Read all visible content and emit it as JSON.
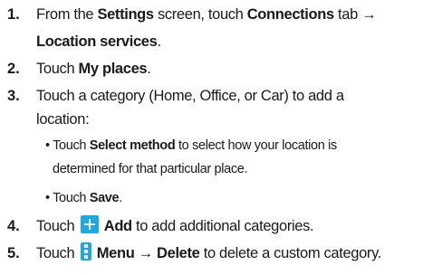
{
  "steps": [
    {
      "number": "1.",
      "line1": [
        "From the ",
        "Settings",
        " screen, touch ",
        "Connections",
        " tab →"
      ],
      "line2": [
        "Location services",
        "."
      ]
    },
    {
      "number": "2.",
      "line1": [
        "Touch ",
        "My places",
        "."
      ]
    },
    {
      "number": "3.",
      "line1": [
        "Touch a category (Home, Office, or Car) to add a"
      ],
      "line2": [
        "location:"
      ],
      "bullets": [
        {
          "line1": [
            "• Touch ",
            "Select method",
            " to select how your location is"
          ],
          "line2": [
            "determined for that particular place."
          ]
        },
        {
          "line1": [
            "• Touch ",
            "Save",
            "."
          ]
        }
      ]
    },
    {
      "number": "4.",
      "line1": [
        "Touch ",
        "Add",
        " to add additional categories."
      ],
      "icon": "add-icon"
    },
    {
      "number": "5.",
      "line1": [
        "Touch ",
        "Menu → Delete",
        " to delete a custom category."
      ],
      "icon": "menu-icon"
    }
  ],
  "icon_color": "#1aa9e1"
}
